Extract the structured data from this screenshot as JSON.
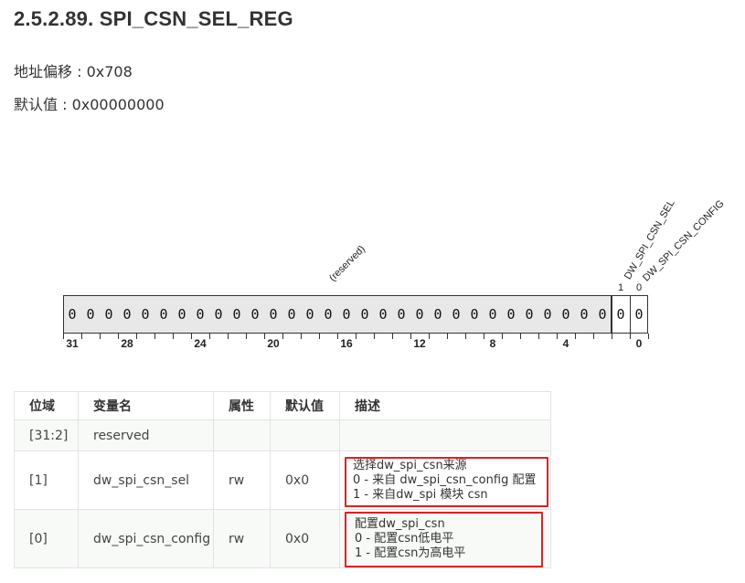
{
  "title": "2.5.2.89. SPI_CSN_SEL_REG",
  "offset_text": "地址偏移 : 0x708",
  "default_text": "默认值 : 0x00000000",
  "diagram": {
    "reserved_label": "(reserved)",
    "field1_label": "DW_SPI_CSN_SEL",
    "field0_label": "DW_SPI_CSN_CONFIG",
    "field1_bitpos": "1",
    "field0_bitpos": "0",
    "bit_value": "0",
    "bit_numbers": [
      "31",
      "28",
      "24",
      "20",
      "16",
      "12",
      "8",
      "4",
      "0"
    ]
  },
  "table": {
    "headers": [
      "位域",
      "变量名",
      "属性",
      "默认值",
      "描述"
    ],
    "rows": [
      {
        "bits": "[31:2]",
        "name": "reserved",
        "attr": "",
        "default": "",
        "desc": []
      },
      {
        "bits": "[1]",
        "name": "dw_spi_csn_sel",
        "attr": "rw",
        "default": "0x0",
        "desc": [
          "选择dw_spi_csn来源",
          "0 - 来自 dw_spi_csn_config 配置",
          "1 - 来自dw_spi 模块 csn"
        ]
      },
      {
        "bits": "[0]",
        "name": "dw_spi_csn_config",
        "attr": "rw",
        "default": "0x0",
        "desc": [
          "配置dw_spi_csn",
          " 0 - 配置csn低电平",
          "1 - 配置csn为高电平"
        ]
      }
    ]
  },
  "colors": {
    "highlight": "#e02020",
    "reserved_fill": "#e8e8e8"
  }
}
